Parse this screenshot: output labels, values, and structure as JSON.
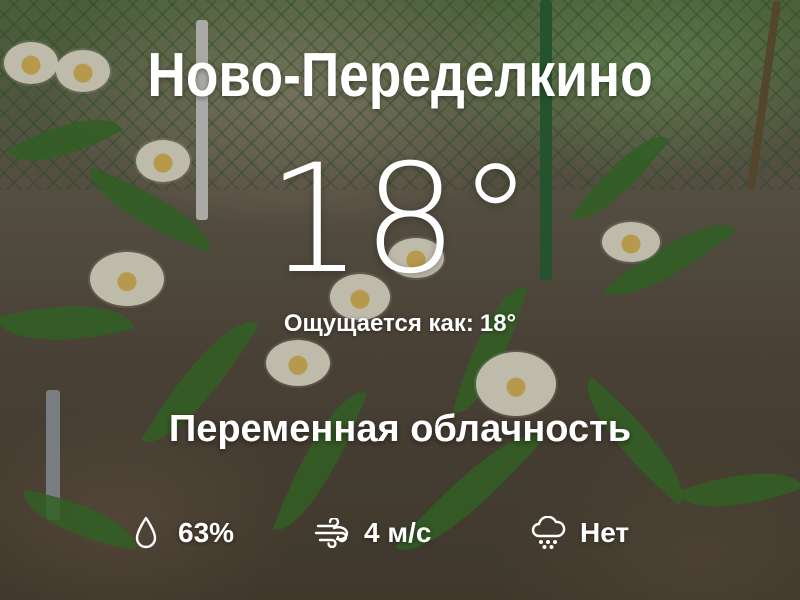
{
  "location": {
    "name": "Ново-Переделкино"
  },
  "current": {
    "temperature": "18°",
    "feels_like_label": "Ощущается как:",
    "feels_like_value": "18°",
    "condition": "Переменная облачность"
  },
  "stats": {
    "humidity": {
      "icon": "humidity-drop-icon",
      "value": "63%"
    },
    "wind": {
      "icon": "wind-icon",
      "value": "4 м/с"
    },
    "precipitation": {
      "icon": "rain-cloud-icon",
      "value": "Нет"
    }
  },
  "background": {
    "description_color_flower": "#f4f0dc",
    "description_color_leaf": "#3f7a2e"
  }
}
